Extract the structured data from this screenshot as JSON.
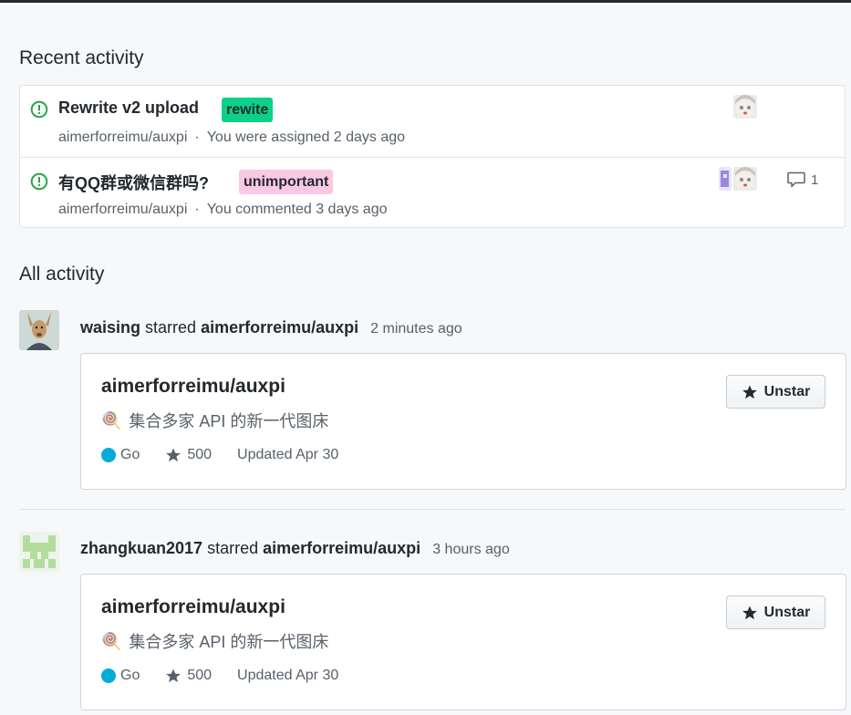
{
  "recent": {
    "title": "Recent activity",
    "items": [
      {
        "title": "Rewrite v2 upload",
        "label": "rewite",
        "label_bg": "#0bd08a",
        "label_fg": "#24292e",
        "repo": "aimerforreimu/auxpi",
        "dot": "·",
        "action": "You were assigned 2 days ago",
        "status_icon": "issue-opened-icon"
      },
      {
        "title": "有QQ群或微信群吗?",
        "label": "unimportant",
        "label_bg": "#f9c8e4",
        "label_fg": "#24292e",
        "repo": "aimerforreimu/auxpi",
        "dot": "·",
        "action": "You commented 3 days ago",
        "comment_count": "1",
        "status_icon": "issue-opened-icon"
      }
    ]
  },
  "all": {
    "title": "All activity",
    "events": [
      {
        "user": "waising",
        "verb": "starred",
        "repo": "aimerforreimu/auxpi",
        "time": "2 minutes ago",
        "card": {
          "name": "aimerforreimu/auxpi",
          "emoji": "🍭",
          "description": "集合多家 API 的新一代图床",
          "language": "Go",
          "language_color": "#00add8",
          "stars": "500",
          "updated": "Updated Apr 30",
          "button": "Unstar"
        }
      },
      {
        "user": "zhangkuan2017",
        "verb": "starred",
        "repo": "aimerforreimu/auxpi",
        "time": "3 hours ago",
        "card": {
          "name": "aimerforreimu/auxpi",
          "emoji": "🍭",
          "description": "集合多家 API 的新一代图床",
          "language": "Go",
          "language_color": "#00add8",
          "stars": "500",
          "updated": "Updated Apr 30",
          "button": "Unstar"
        }
      }
    ]
  },
  "colors": {
    "issue_open": "#28a745",
    "text": "#24292e",
    "muted": "#586069"
  }
}
